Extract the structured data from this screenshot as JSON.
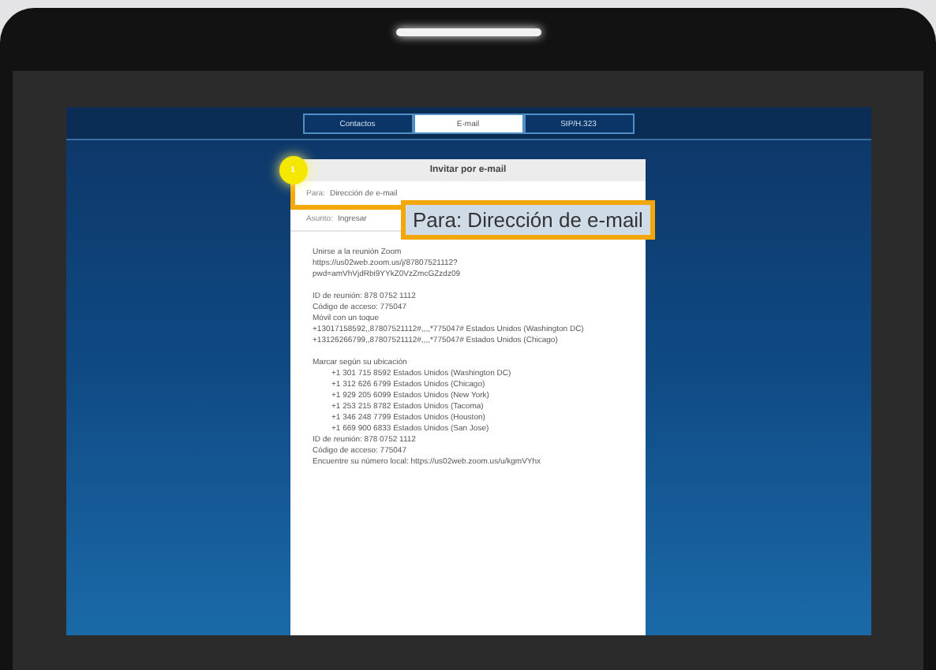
{
  "tabs": [
    {
      "label": "Contactos",
      "selected": false
    },
    {
      "label": "E-mail",
      "selected": true
    },
    {
      "label": "SIP/H.323",
      "selected": false
    }
  ],
  "dialog": {
    "title": "Invitar por e-mail",
    "to": {
      "label": "Para:",
      "placeholder": "Dirección de e-mail"
    },
    "subject": {
      "label": "Asunto:",
      "value": "Ingresar"
    },
    "body": [
      [
        "Unirse a la reunión Zoom",
        "https://us02web.zoom.us/j/87807521112?",
        "pwd=amVhVjdRbi9YYkZ0VzZmcGZzdz09"
      ],
      [
        "ID de reunión: 878 0752 1112",
        "Código de acceso: 775047",
        "Móvil con un toque",
        "+13017158592,,87807521112#,,,,*775047# Estados Unidos (Washington DC)",
        "+13126266799,,87807521112#,,,,*775047# Estados Unidos (Chicago)"
      ]
    ],
    "dial_heading": "Marcar según su ubicación",
    "dial_numbers": [
      "+1 301 715 8592 Estados Unidos (Washington DC)",
      "+1 312 626 6799 Estados Unidos (Chicago)",
      "+1 929 205 6099 Estados Unidos (New York)",
      "+1 253 215 8782 Estados Unidos (Tacoma)",
      "+1 346 248 7799 Estados Unidos (Houston)",
      "+1 669 900 6833 Estados Unidos (San Jose)"
    ],
    "footer": [
      "ID de reunión: 878 0752 1112",
      "Código de acceso: 775047",
      "Encuentre su número local: https://us02web.zoom.us/u/kgmVYhx"
    ]
  },
  "callout": {
    "number": "1",
    "text": "Para: Dirección de e-mail"
  }
}
